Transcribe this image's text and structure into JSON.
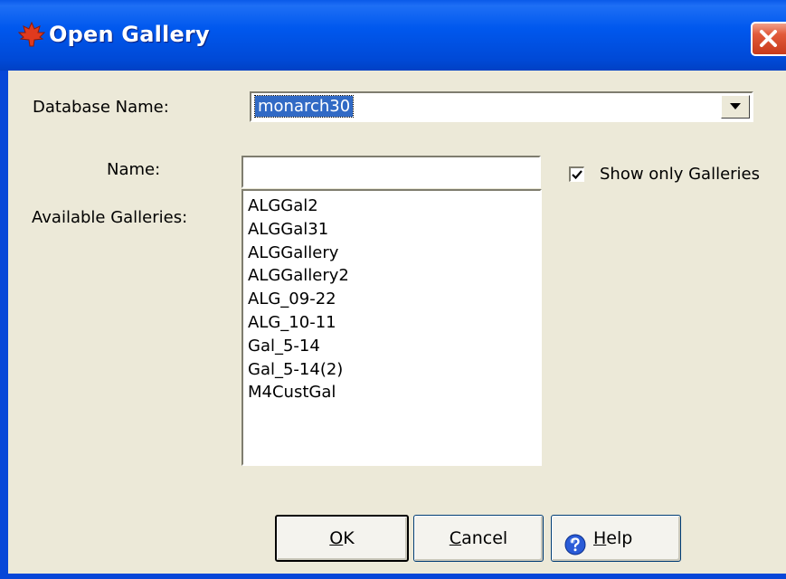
{
  "window": {
    "title": "Open Gallery"
  },
  "database": {
    "label": "Database Name:",
    "selected_value": "monarch30"
  },
  "name_field": {
    "label": "Name:",
    "value": ""
  },
  "show_only_galleries": {
    "label": "Show only Galleries",
    "checked": true
  },
  "available_galleries": {
    "label": "Available Galleries:",
    "items": [
      "ALGGal2",
      "ALGGal31",
      "ALGGallery",
      "ALGGallery2",
      "ALG_09-22",
      "ALG_10-11",
      "Gal_5-14",
      "Gal_5-14(2)",
      "M4CustGal"
    ]
  },
  "buttons": {
    "ok": {
      "mnemonic": "O",
      "rest": "K"
    },
    "cancel": {
      "mnemonic": "C",
      "rest": "ancel"
    },
    "help": {
      "mnemonic": "H",
      "rest": "elp"
    }
  },
  "icons": {
    "title_logo": "maple-leaf-icon",
    "close": "close-icon",
    "dropdown": "chevron-down-icon",
    "check": "checkmark-icon",
    "help": "help-question-icon"
  },
  "colors": {
    "title_bar": "#0058ee",
    "dialog_bg": "#ece9d8",
    "selection": "#316ac5",
    "close_button": "#e25a3a",
    "logo": "#e03a1e",
    "help_icon": "#2a5bd7"
  }
}
